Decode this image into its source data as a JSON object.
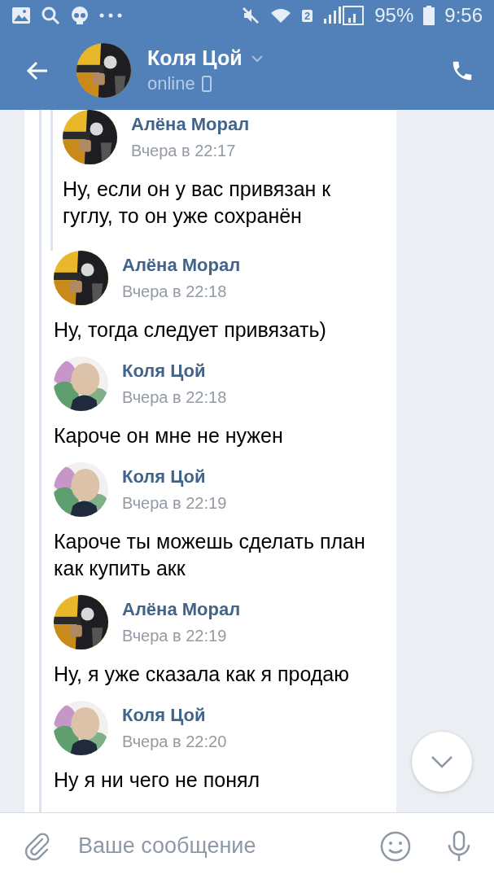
{
  "status_bar": {
    "sim_badge": "2",
    "battery": "95%",
    "time": "9:56"
  },
  "header": {
    "title": "Коля Цой",
    "status": "online"
  },
  "messages": [
    {
      "kind": "nested",
      "author": "Алёна Морал",
      "time": "Вчера в 22:17",
      "text": "Ну, если он у вас привязан к гуглу, то он уже сохранён"
    },
    {
      "kind": "plain",
      "author": "Алёна Морал",
      "time": "Вчера в 22:18",
      "text": "Ну, тогда следует привязать)"
    },
    {
      "kind": "plain",
      "author": "Коля Цой",
      "time": "Вчера в 22:18",
      "text": "Кароче он мне не нужен"
    },
    {
      "kind": "plain",
      "author": "Коля Цой",
      "time": "Вчера в 22:19",
      "text": "Кароче ты можешь сделать план как купить акк"
    },
    {
      "kind": "plain",
      "author": "Алёна Морал",
      "time": "Вчера в 22:19",
      "text": "Ну, я уже сказала как я продаю"
    },
    {
      "kind": "plain",
      "author": "Коля Цой",
      "time": "Вчера в 22:20",
      "text": "Ну я ни чего не понял"
    }
  ],
  "composer": {
    "placeholder": "Ваше сообщение"
  }
}
